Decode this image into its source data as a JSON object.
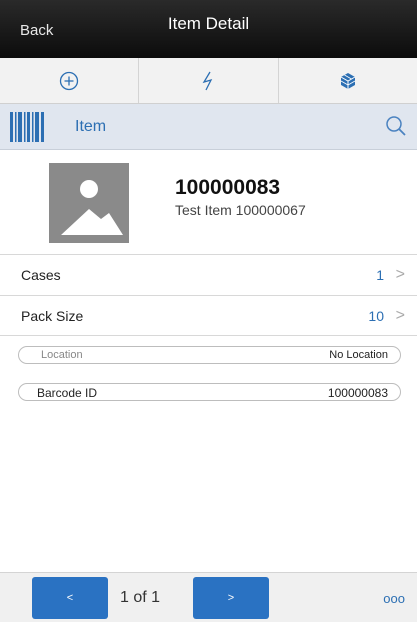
{
  "header": {
    "back_label": "Back",
    "title": "Item Detail"
  },
  "toolbar": {
    "items": [
      {
        "icon": "plus-circle-icon"
      },
      {
        "icon": "lightning-icon"
      },
      {
        "icon": "cube-icon"
      }
    ]
  },
  "search_bar": {
    "label": "Item",
    "icons": [
      "barcode-icon",
      "search-icon"
    ]
  },
  "item": {
    "id": "100000083",
    "description": "Test Item 100000067",
    "image_icon": "image-placeholder-icon"
  },
  "details": [
    {
      "label": "Cases",
      "value": "1"
    },
    {
      "label": "Pack Size",
      "value": "10"
    }
  ],
  "fields": [
    {
      "label": "Location",
      "value": "No Location"
    },
    {
      "label": "Barcode ID",
      "value": "100000083"
    }
  ],
  "footer": {
    "prev_label": "<",
    "next_label": ">",
    "pager": "1 of 1",
    "more_label": "ooo"
  },
  "colors": {
    "accent": "#2a72c2",
    "link": "#2c6fb3",
    "header_bg": "#111111",
    "search_bg": "#e0e6ef"
  }
}
